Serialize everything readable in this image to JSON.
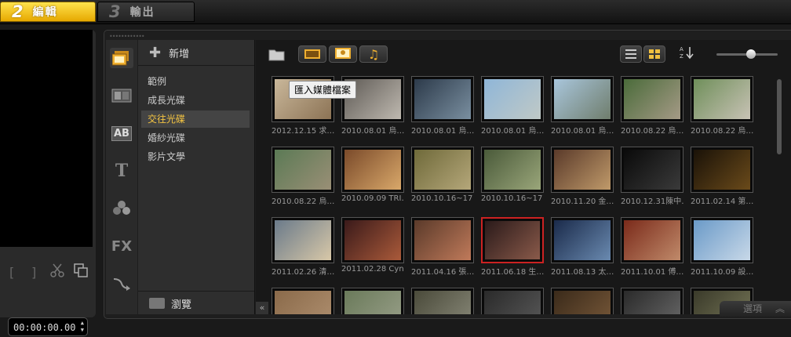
{
  "steps": [
    {
      "num": "2",
      "label": "編輯"
    },
    {
      "num": "3",
      "label": "輸出"
    }
  ],
  "preview": {
    "mark_in": "[",
    "mark_out": "]",
    "timecode": "00:00:00.00"
  },
  "library": {
    "add_label": "新增",
    "folders": [
      "範例",
      "成長光碟",
      "交往光碟",
      "婚紗光碟",
      "影片文學"
    ],
    "selected_folder": "交往光碟",
    "browse_label": "瀏覽",
    "import_tooltip": "匯入媒體檔案",
    "options_label": "選項",
    "sidebar_icons": [
      "media-icon",
      "transition-icon",
      "title-icon",
      "text-icon",
      "graphics-icon",
      "filter-icon",
      "path-icon"
    ],
    "thumbnails": [
      {
        "caption": "2012.12.15 求…",
        "colors": [
          "#c9b79a",
          "#8c7355"
        ]
      },
      {
        "caption": "2010.08.01 烏…",
        "colors": [
          "#5e5a55",
          "#bfb9b0"
        ]
      },
      {
        "caption": "2010.08.01 烏…",
        "colors": [
          "#2c3a4a",
          "#7a8fa0"
        ]
      },
      {
        "caption": "2010.08.01 烏…",
        "colors": [
          "#8fb6d8",
          "#c0c9c6"
        ]
      },
      {
        "caption": "2010.08.01 烏…",
        "colors": [
          "#a9c6dc",
          "#6f7d6c"
        ]
      },
      {
        "caption": "2010.08.22 烏…",
        "colors": [
          "#4a6b3a",
          "#a59a86"
        ]
      },
      {
        "caption": "2010.08.22 烏…",
        "colors": [
          "#6f8f5a",
          "#c8c2b5"
        ]
      },
      {
        "caption": "2010.08.22 烏…",
        "colors": [
          "#5b7a55",
          "#9a8f76"
        ]
      },
      {
        "caption": "2010.09.09 TRI…",
        "colors": [
          "#7a4a2a",
          "#d9a86a"
        ]
      },
      {
        "caption": "2010.10.16~17 …",
        "colors": [
          "#6f6a3a",
          "#b5a77a"
        ]
      },
      {
        "caption": "2010.10.16~17 …",
        "colors": [
          "#4a5a3a",
          "#9aa67a"
        ]
      },
      {
        "caption": "2010.11.20 金…",
        "colors": [
          "#5a3a2a",
          "#c09a6a"
        ]
      },
      {
        "caption": "2010.12.31陳中…",
        "colors": [
          "#0a0a0a",
          "#3a3a3a"
        ]
      },
      {
        "caption": "2011.02.14 第…",
        "colors": [
          "#1a1208",
          "#6a4a1a"
        ]
      },
      {
        "caption": "2011.02.26 清…",
        "colors": [
          "#6a7a8a",
          "#d8c8a8"
        ]
      },
      {
        "caption": "2011.02.28 Cyn…",
        "colors": [
          "#3a1a1a",
          "#aa5a3a"
        ]
      },
      {
        "caption": "2011.04.16 張…",
        "colors": [
          "#5a3a2a",
          "#c07a5a"
        ]
      },
      {
        "caption": "2011.06.18 生…",
        "colors": [
          "#2a1a1a",
          "#8a5a4a"
        ]
      },
      {
        "caption": "2011.08.13 太…",
        "colors": [
          "#1a2a4a",
          "#6a8ab0"
        ]
      },
      {
        "caption": "2011.10.01 傅…",
        "colors": [
          "#7a2a1a",
          "#c08a6a"
        ]
      },
      {
        "caption": "2011.10.09 設…",
        "colors": [
          "#6a9ac8",
          "#c8d8e8"
        ]
      },
      {
        "caption": "",
        "colors": [
          "#8a6a4a",
          "#b09070"
        ]
      },
      {
        "caption": "",
        "colors": [
          "#6a7a5a",
          "#9aa08a"
        ]
      },
      {
        "caption": "",
        "colors": [
          "#4a4a3a",
          "#8a8a7a"
        ]
      },
      {
        "caption": "",
        "colors": [
          "#2a2a2a",
          "#5a5a5a"
        ]
      },
      {
        "caption": "",
        "colors": [
          "#3a2a1a",
          "#7a5a3a"
        ]
      },
      {
        "caption": "",
        "colors": [
          "#2a2a2a",
          "#6a6a6a"
        ]
      },
      {
        "caption": "",
        "colors": [
          "#3a3a2a",
          "#7a7a5a"
        ]
      }
    ],
    "selected_thumbnail_index": 17
  }
}
